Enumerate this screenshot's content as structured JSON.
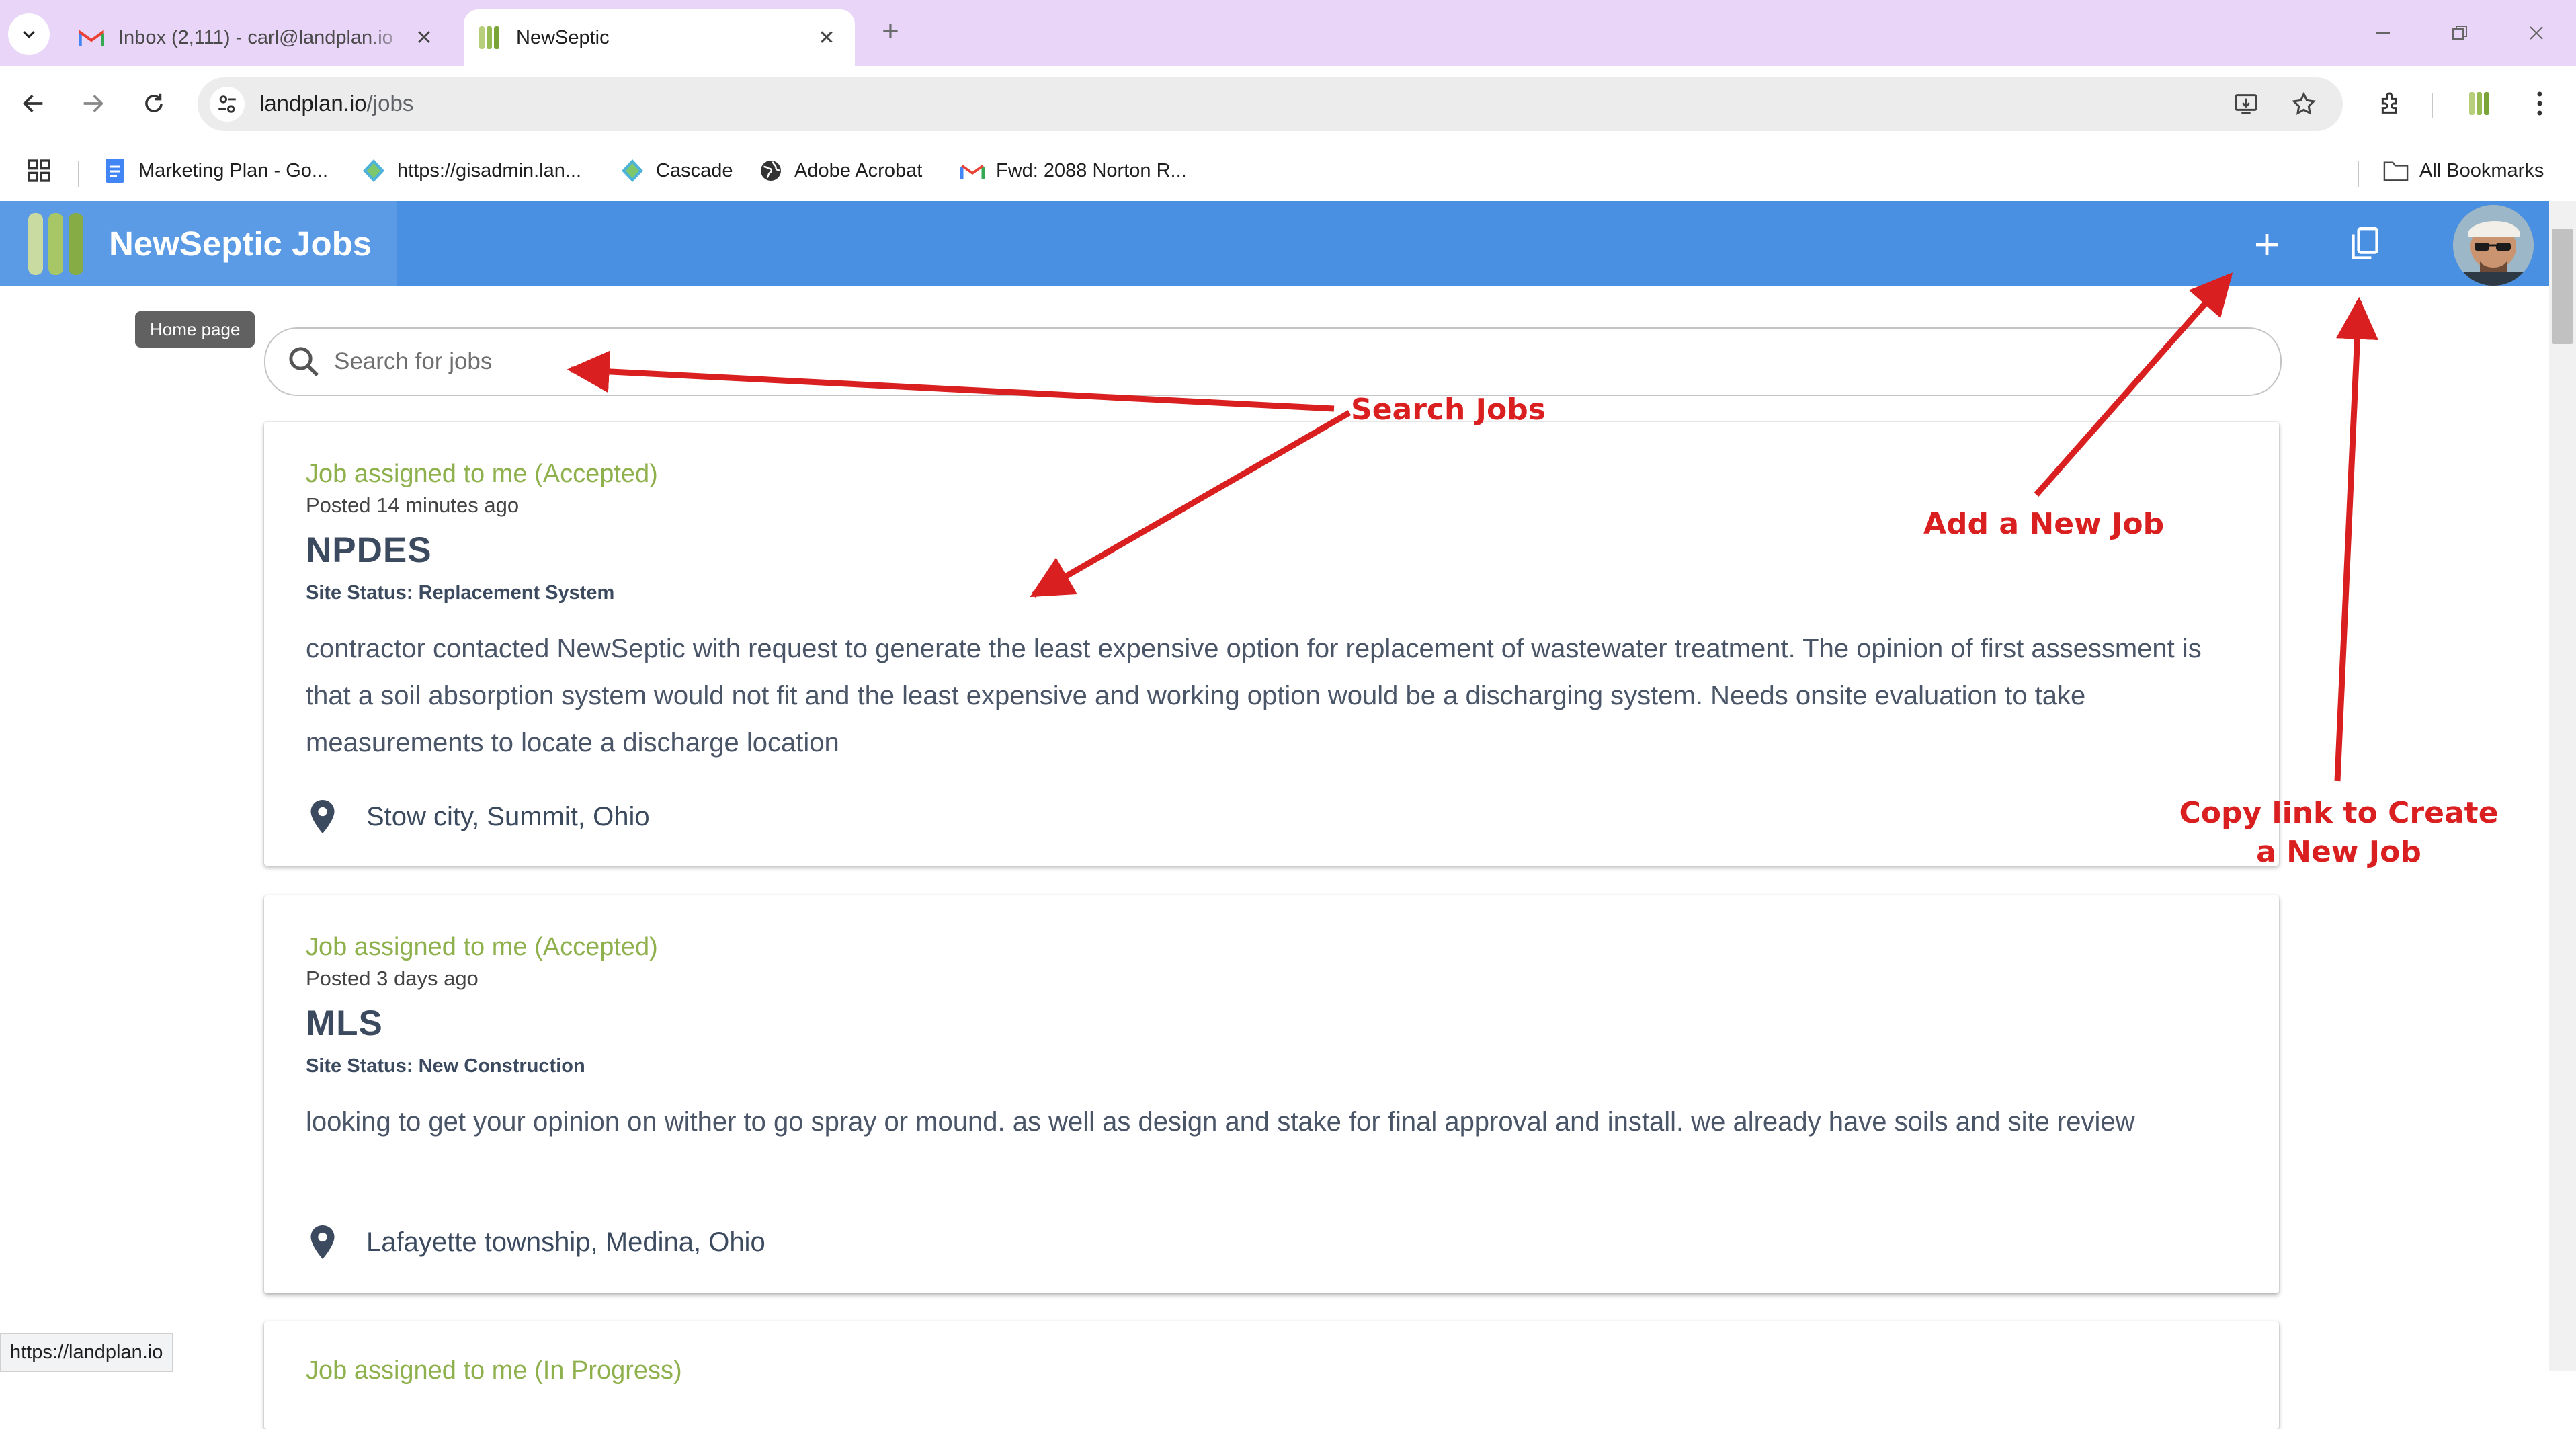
{
  "browser": {
    "tabs": [
      {
        "title": "Inbox (2,111) - carl@landplan.io",
        "favicon": "gmail-icon",
        "active": false
      },
      {
        "title": "NewSeptic",
        "favicon": "newseptic-logo-icon",
        "active": true
      }
    ],
    "new_tab_label": "+",
    "address": {
      "host": "landplan.io",
      "path": "/jobs"
    },
    "bookmarks": [
      {
        "label": "Marketing Plan - Go...",
        "icon": "google-docs-icon"
      },
      {
        "label": "https://gisadmin.lan...",
        "icon": "gis-globe-icon"
      },
      {
        "label": "Cascade",
        "icon": "gis-globe-icon"
      },
      {
        "label": "Adobe Acrobat",
        "icon": "globe-icon"
      },
      {
        "label": "Fwd: 2088 Norton R...",
        "icon": "gmail-icon"
      }
    ],
    "all_bookmarks_label": "All Bookmarks",
    "status_url": "https://landplan.io"
  },
  "app": {
    "title": "NewSeptic Jobs",
    "tooltip": "Home page",
    "search_placeholder": "Search for jobs",
    "colors": {
      "appbar": "#4a90e2",
      "status_green": "#8fb14d",
      "annotation_red": "#d91f1f"
    }
  },
  "jobs": [
    {
      "status": "Job assigned to me (Accepted)",
      "posted": "Posted 14 minutes ago",
      "title": "NPDES",
      "site_status": "Site Status: Replacement System",
      "description": "contractor contacted NewSeptic with request to generate the least expensive option for replacement of wastewater treatment. The opinion of first assessment is that a soil absorption system would not fit and the least expensive and working option would be a discharging system. Needs onsite evaluation to take measurements to locate a discharge location",
      "location": "Stow city, Summit, Ohio"
    },
    {
      "status": "Job assigned to me (Accepted)",
      "posted": "Posted 3 days ago",
      "title": "MLS",
      "site_status": "Site Status: New Construction",
      "description": "looking to get your opinion on wither to go spray or mound. as well as design and stake for final approval and install. we already have soils and site review",
      "location": "Lafayette township, Medina, Ohio"
    },
    {
      "status": "Job assigned to me (In Progress)"
    }
  ],
  "annotations": {
    "search": "Search Jobs",
    "add": "Add a New Job",
    "copy": "Copy link to Create a New Job"
  }
}
